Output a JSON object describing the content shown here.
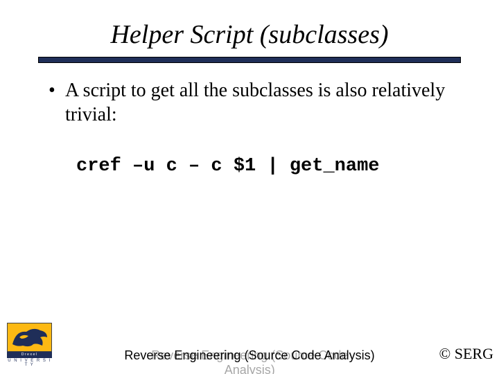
{
  "title": "Helper Script (subclasses)",
  "bullet": {
    "dot": "•",
    "text": "A script to get all the subclasses is also relatively trivial:"
  },
  "code": "cref –u c – c $1 | get_name",
  "logo": {
    "wordmark": "Drexel",
    "caption": "U N I V E R S I T Y"
  },
  "footer_center": "Reverse Engineering (Source Code Analysis)",
  "footer_right": "© SERG"
}
